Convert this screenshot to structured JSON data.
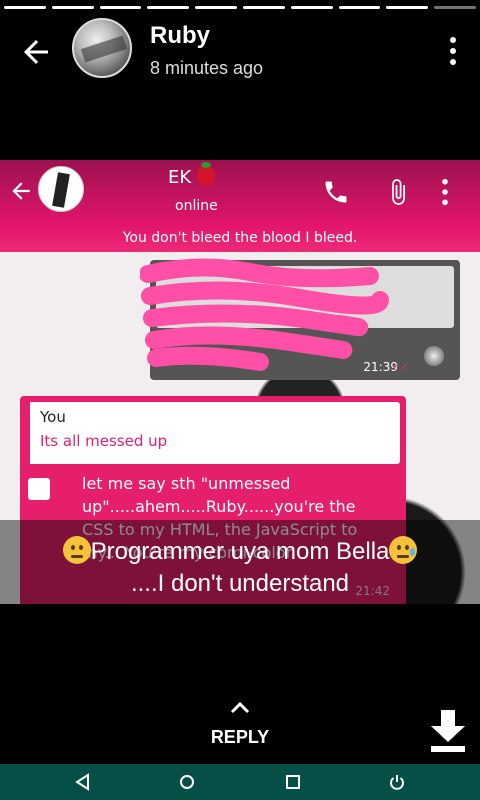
{
  "status": {
    "contact_name": "Ruby",
    "timestamp": "8 minutes ago",
    "progress_segments": 10,
    "current_segment": 10
  },
  "screenshot": {
    "chat_name": "EK",
    "chat_status": "online",
    "about": "You don't bleed the blood I bleed.",
    "outgoing_time": "21:39",
    "reply_quote": {
      "author": "You",
      "text": "Its all messed up"
    },
    "incoming_text": "let me say sth \"unmessed up\".....ahem.....Ruby......you're the CSS to my HTML, the JavaScript to my... You're my comi-color",
    "incoming_time": "21:42"
  },
  "caption": {
    "line1": "Programmer uya mom Bella",
    "line2": "....I don't understand"
  },
  "reply_label": "REPLY",
  "icons": {
    "back": "arrow-left-icon",
    "menu": "more-vert-icon",
    "call": "phone-icon",
    "attach": "paperclip-icon",
    "download": "download-icon",
    "nav_back": "triangle-back-icon",
    "nav_home": "circle-home-icon",
    "nav_recents": "square-recents-icon",
    "nav_power": "power-icon"
  },
  "colors": {
    "accent": "#e51f6b",
    "navbar": "#064f47"
  }
}
